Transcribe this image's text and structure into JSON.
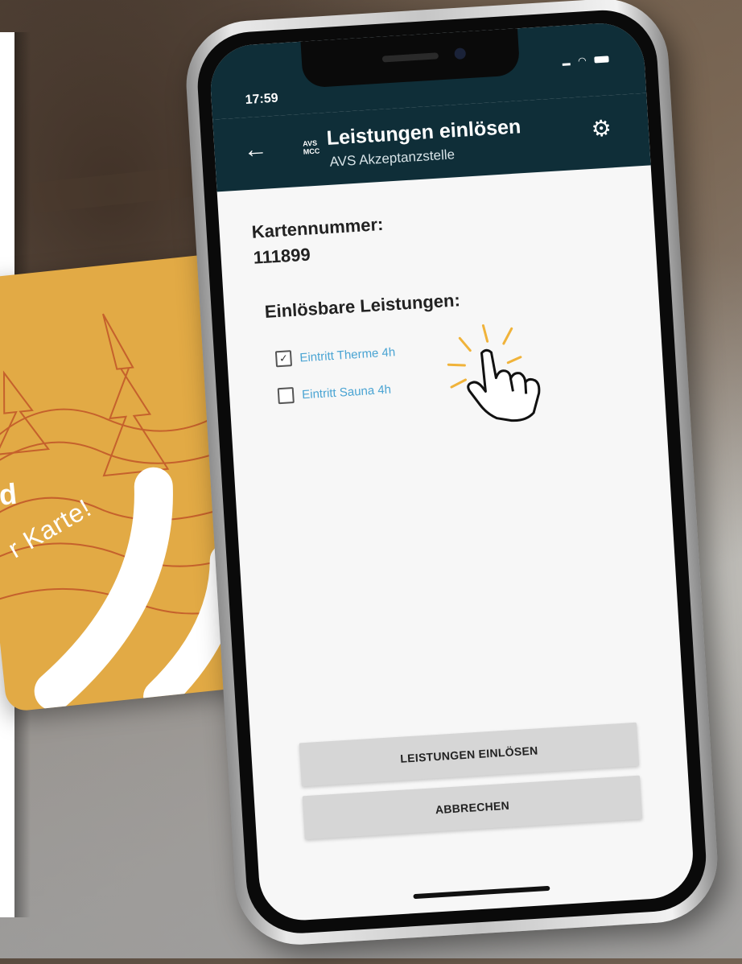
{
  "status": {
    "time": "17:59"
  },
  "app_bar": {
    "logo_text": "AVS MCC",
    "title": "Leistungen einlösen",
    "subtitle": "AVS Akzeptanzstelle",
    "back_icon": "arrow-back-icon",
    "settings_icon": "gear-icon"
  },
  "card_number": {
    "label": "Kartennummer:",
    "value": "111899"
  },
  "services": {
    "label": "Einlösbare Leistungen:",
    "items": [
      {
        "label": "Eintritt Therme 4h",
        "checked": true
      },
      {
        "label": "Eintritt Sauna 4h",
        "checked": false
      }
    ]
  },
  "buttons": {
    "redeem": "LEISTUNGEN EINLÖSEN",
    "cancel": "ABBRECHEN"
  },
  "card_overlay": {
    "text": "r Karte!",
    "bold": "d"
  },
  "colors": {
    "app_bar": "#0f2e38",
    "link": "#4aa4d3",
    "card": "#e2aa45",
    "button": "#d6d6d6"
  }
}
